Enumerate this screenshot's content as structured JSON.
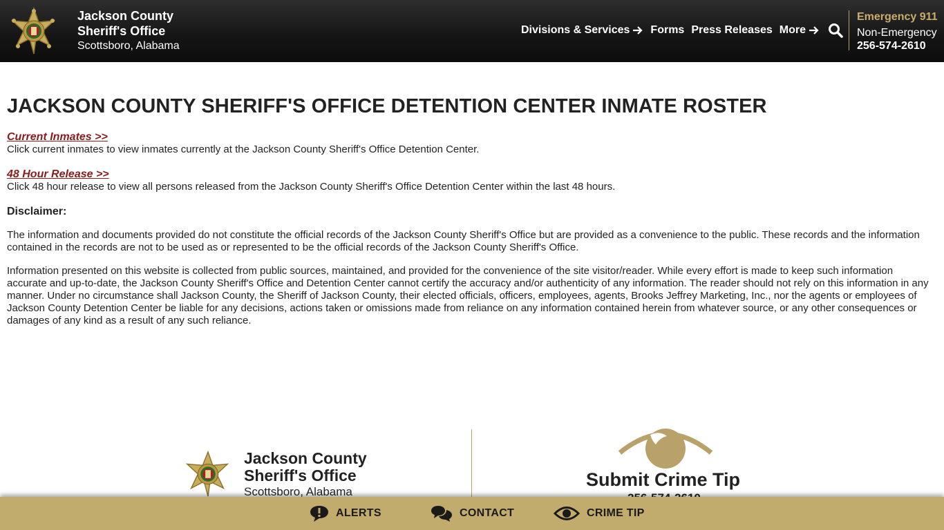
{
  "header": {
    "brand_line1": "Jackson County",
    "brand_line2": "Sheriff's Office",
    "brand_line3": "Scottsboro, Alabama",
    "nav": [
      {
        "label": "Divisions & Services"
      },
      {
        "label": "Forms"
      },
      {
        "label": "Press Releases"
      },
      {
        "label": "More"
      }
    ],
    "emergency_label": "Emergency 911",
    "non_emergency_label": "Non-Emergency",
    "non_emergency_phone": "256-574-2610"
  },
  "main": {
    "title": "JACKSON COUNTY SHERIFF'S OFFICE DETENTION CENTER INMATE ROSTER",
    "current_link": "Current Inmates >>",
    "current_desc": "Click current inmates to view inmates currently at the Jackson County Sheriff's Office Detention Center.",
    "release_link": "48 Hour Release >>",
    "release_desc": "Click 48 hour release to view all persons released from the Jackson County Sheriff's Office Detention Center within the last 48 hours.",
    "disclaimer_heading": "Disclaimer:",
    "disclaimer_p1": "The information and documents provided do not constitute the official records of the Jackson County Sheriff's Office but are provided as a convenience to the public.  These records and the information contained in the records are not to be used as or represented to be the official records of the Jackson County Sheriff's Office.",
    "disclaimer_p2": "Information presented on this website is collected from public sources, maintained, and provided for the convenience of the site visitor/reader. While every effort is made to keep such information accurate and up-to-date, the Jackson County Sheriff's Office and Detention Center cannot certify the accuracy and/or authenticity of any information. The reader should not rely on this information in any manner. Under no circumstance shall Jackson County, the Sheriff of Jackson County, their elected officials, officers, employees, agents, Brooks Jeffrey Marketing, Inc., nor the agents or employees of Jackson County Detention Center be liable for any decisions, actions taken or omissions made from reliance on any information contained herein from whatever source, or any other consequences or damages of any kind as a result of any such reliance."
  },
  "footer": {
    "brand_line1": "Jackson County",
    "brand_line2": "Sheriff's Office",
    "brand_line3": "Scottsboro, Alabama",
    "tip_title": "Submit Crime Tip",
    "tip_phone": "256-574-2610"
  },
  "bottom_bar": {
    "alerts": "ALERTS",
    "contact": "CONTACT",
    "crime_tip": "CRIME TIP"
  },
  "colors": {
    "gold": "#c2ac6d",
    "link_red": "#8b1a1a",
    "header_bg": "#151515"
  },
  "icons": [
    "sheriff-badge-icon",
    "arrow-right-icon",
    "search-icon",
    "eye-icon",
    "alert-bubble-icon",
    "chat-bubbles-icon"
  ]
}
